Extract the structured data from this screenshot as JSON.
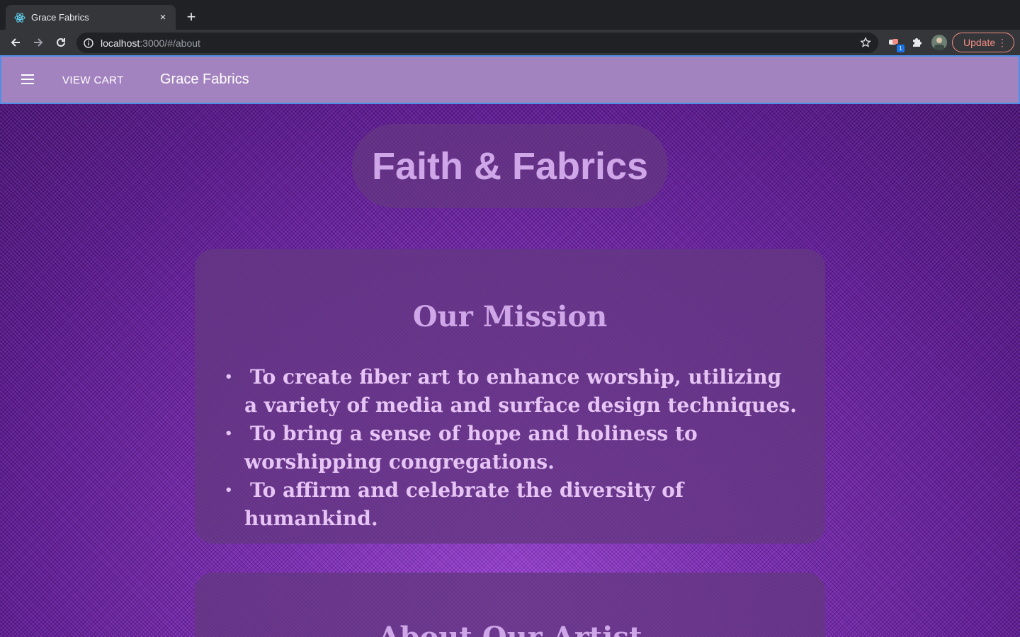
{
  "browser": {
    "tab_title": "Grace Fabrics",
    "tab_close": "×",
    "new_tab": "+",
    "url_host": "localhost",
    "url_path": ":3000/#/about",
    "extension_badge": "1",
    "update_label": "Update",
    "menu_dots": "⋮"
  },
  "appbar": {
    "view_cart_label": "VIEW CART",
    "brand": "Grace Fabrics"
  },
  "hero": {
    "title": "Faith & Fabrics"
  },
  "mission": {
    "heading": "Our Mission",
    "items": [
      "To create fiber art to enhance worship, utilizing a variety of media and surface design techniques.",
      "To bring a sense of hope and holiness to worshipping congregations.",
      "To affirm and celebrate the diversity of humankind."
    ]
  },
  "artist": {
    "heading": "About Our Artist"
  },
  "colors": {
    "appbar": "#a383bf",
    "accent_text": "#cfa6e8",
    "card_bg": "#643782",
    "fabric": "#6a1d9c",
    "update": "#f28b82"
  },
  "icons": {
    "tab_favicon": "react-atom-icon",
    "back": "arrow-left-icon",
    "forward": "arrow-right-icon",
    "reload": "reload-icon",
    "site_info": "info-icon",
    "bookmark": "star-icon",
    "extension_1": "extension-badge-icon",
    "extension_2": "puzzle-icon",
    "menu": "hamburger-menu-icon"
  }
}
